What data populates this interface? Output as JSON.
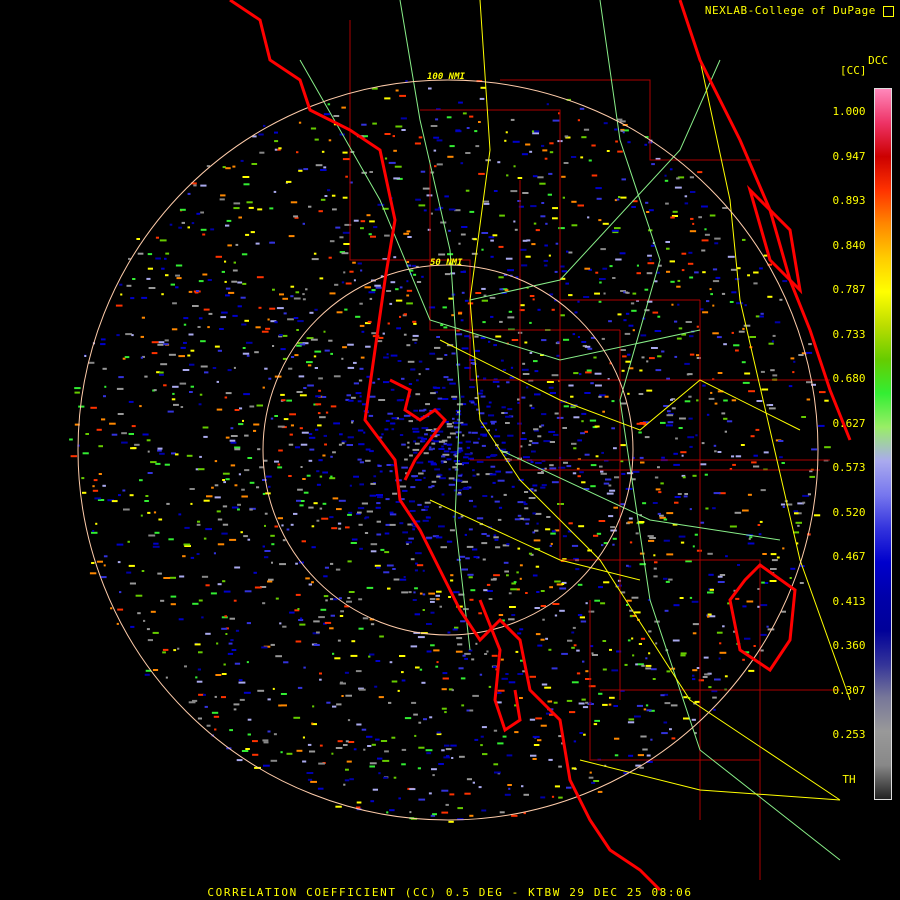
{
  "header": {
    "credit": "NEXLAB-College of DuPage",
    "credit_icon": "radar-logo-icon"
  },
  "legend": {
    "code": "DCC",
    "unit": "[CC]",
    "ticks": [
      "1.000",
      "0.947",
      "0.893",
      "0.840",
      "0.787",
      "0.733",
      "0.680",
      "0.627",
      "0.573",
      "0.520",
      "0.467",
      "0.413",
      "0.360",
      "0.307",
      "0.253",
      "TH"
    ],
    "colors": [
      "#ff88bb",
      "#ee3366",
      "#cc0000",
      "#ff3300",
      "#ff8800",
      "#ffcc00",
      "#ffff00",
      "#bbdd00",
      "#66cc00",
      "#33ee33",
      "#99ee66",
      "#aaaaee",
      "#7777ee",
      "#3333dd",
      "#0000cc",
      "#0000aa",
      "#000099",
      "#333399",
      "#777799",
      "#999999",
      "#888888",
      "#222222"
    ]
  },
  "rings": {
    "inner_label": "50 NMI",
    "outer_label": "100 NMI"
  },
  "footer": {
    "caption": "CORRELATION COEFFICIENT (CC) 0.5 DEG - KTBW 29 DEC 25 08:06"
  },
  "colors": {
    "coast": "#ff0000",
    "roads": "#ffff00",
    "highways": "#88ee88",
    "counties": "#aa0000",
    "rings": "#ffccaa"
  }
}
